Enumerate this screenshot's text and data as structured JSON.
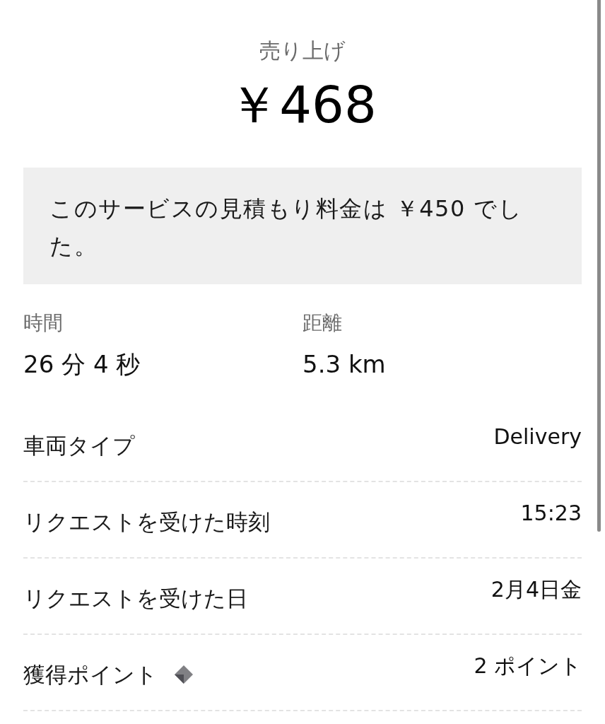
{
  "summary": {
    "label": "売り上げ",
    "amount": "￥468"
  },
  "notice": "このサービスの見積もり料金は ￥450 でした。",
  "stats": [
    {
      "label": "時間",
      "value": "26 分 4 秒"
    },
    {
      "label": "距離",
      "value": "5.3 km"
    }
  ],
  "details": [
    {
      "kind": "plain",
      "label": "車両タイプ",
      "value": "Delivery"
    },
    {
      "kind": "plain",
      "label": "リクエストを受けた時刻",
      "value": "15:23"
    },
    {
      "kind": "plain",
      "label": "リクエストを受けた日",
      "value": "2月4日金"
    },
    {
      "kind": "points",
      "label": "獲得ポイント",
      "value": "2 ポイント"
    }
  ]
}
